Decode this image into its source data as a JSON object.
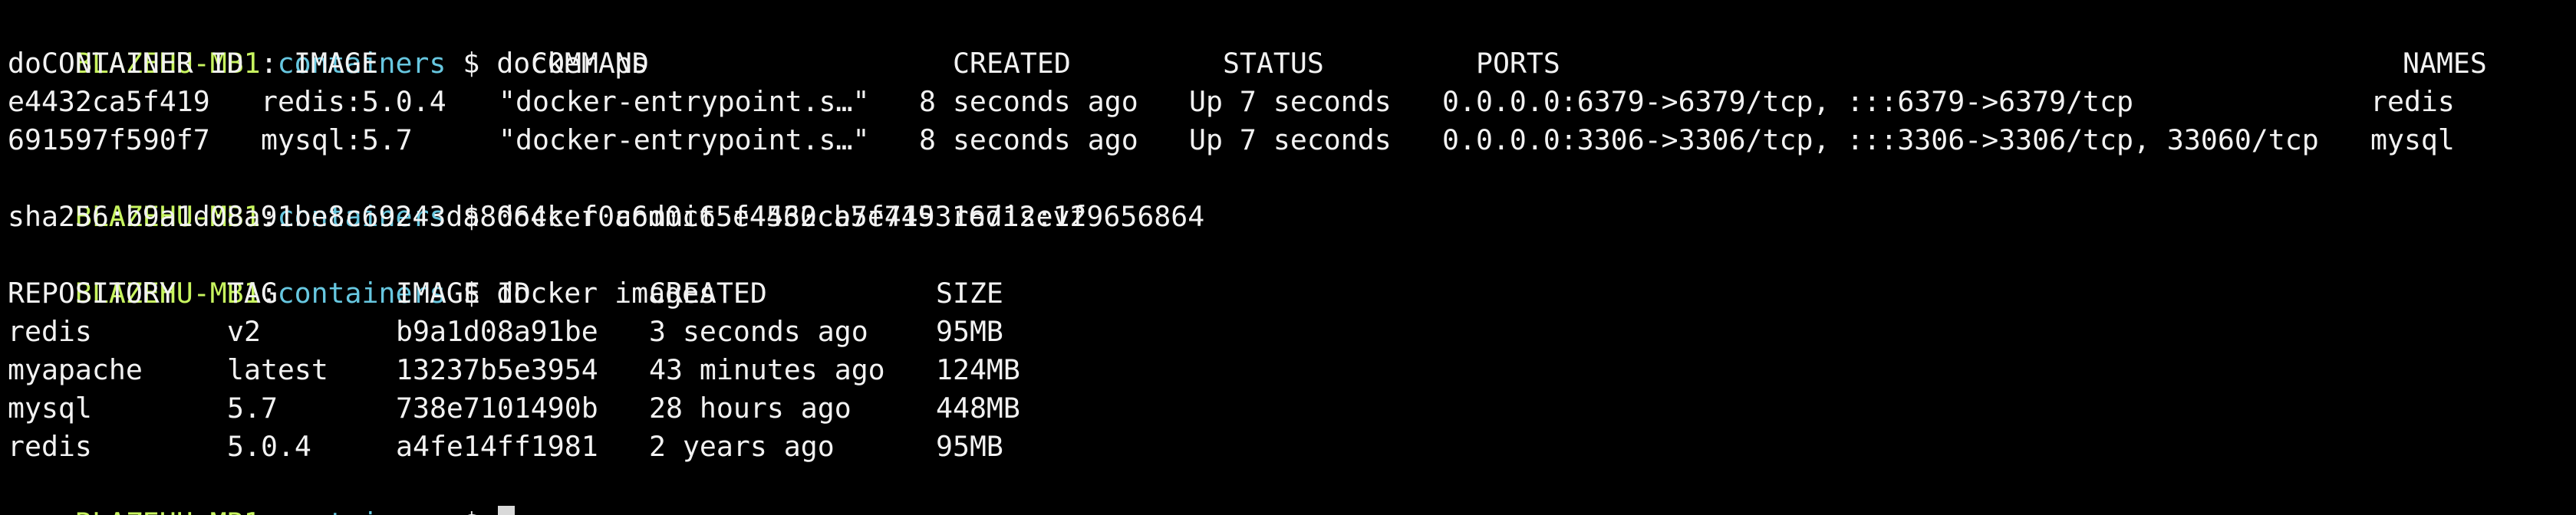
{
  "colors": {
    "background": "#000000",
    "text": "#f2f2f2",
    "prompt_host": "#c8f55f",
    "prompt_dir": "#67c7e0",
    "cursor": "#d9d9d9"
  },
  "prompt": {
    "host": "BLAZEHU-MB1",
    "separator": ":",
    "dir": "containers",
    "symbol": " $ "
  },
  "commands": {
    "ps": "docker ps",
    "commit": "docker commit e4432ca5f419 redis:v2",
    "images": "docker images"
  },
  "ps_table": {
    "headers": [
      "doCONTAINER ID",
      "IMAGE",
      "COMMAND",
      "CREATED",
      "STATUS",
      "PORTS",
      "NAMES"
    ],
    "rows": [
      [
        "e4432ca5f419",
        "redis:5.0.4",
        "\"docker-entrypoint.s…\"",
        "8 seconds ago",
        "Up 7 seconds",
        "0.0.0.0:6379->6379/tcp, :::6379->6379/tcp",
        "redis"
      ],
      [
        "691597f590f7",
        "mysql:5.7",
        "\"docker-entrypoint.s…\"",
        "8 seconds ago",
        "Up 7 seconds",
        "0.0.0.0:3306->3306/tcp, :::3306->3306/tcp, 33060/tcp",
        "mysql"
      ]
    ]
  },
  "commit_output": "sha256:b9a1d08a91be8c69243da8064cef0a6d0c65f4560cb7e745316712e1f9656864",
  "images_table": {
    "headers": [
      "REPOSITORY",
      "TAG",
      "IMAGE ID",
      "CREATED",
      "SIZE"
    ],
    "rows": [
      [
        "redis",
        "v2",
        "b9a1d08a91be",
        "3 seconds ago",
        "95MB"
      ],
      [
        "myapache",
        "latest",
        "13237b5e3954",
        "43 minutes ago",
        "124MB"
      ],
      [
        "mysql",
        "5.7",
        "738e7101490b",
        "28 hours ago",
        "448MB"
      ],
      [
        "redis",
        "5.0.4",
        "a4fe14ff1981",
        "2 years ago",
        "95MB"
      ]
    ]
  }
}
